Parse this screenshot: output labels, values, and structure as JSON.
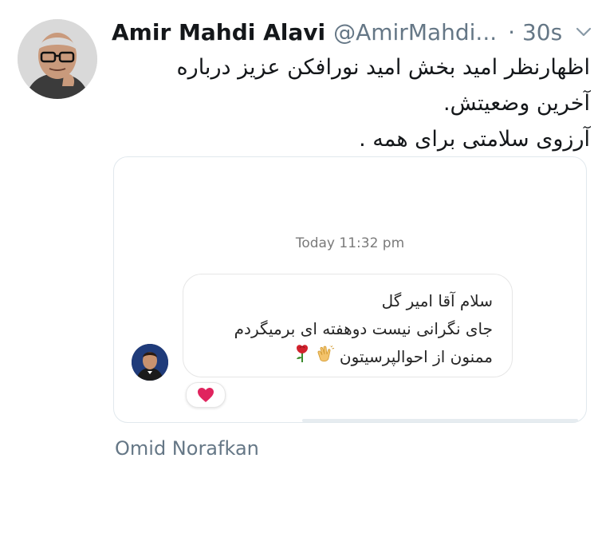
{
  "tweet": {
    "author_name": "Amir Mahdi Alavi",
    "author_handle": "@AmirMahdi...",
    "time": "· 30s",
    "menu_icon": "chevron-down-icon",
    "text_lines": [
      "اظهارنظر امید بخش امید نورافکن عزیز درباره",
      "آخرین وضعیتش.",
      "آرزوی سلامتی برای همه ."
    ]
  },
  "screenshot": {
    "timestamp": "Today 11:32 pm",
    "message_lines": [
      "سلام آقا امیر گل",
      "جای نگرانی نیست دوهفته ای برمیگردم",
      "ممنون از احوالپرسیتون"
    ],
    "message_emojis": [
      "clapping-hands-icon",
      "rose-icon"
    ],
    "reaction": "heart-icon"
  },
  "attribution": "Omid Norafkan",
  "colors": {
    "text_primary": "#14171a",
    "text_secondary": "#657786",
    "border": "#e1e8ed",
    "heart": "#e0245e"
  }
}
